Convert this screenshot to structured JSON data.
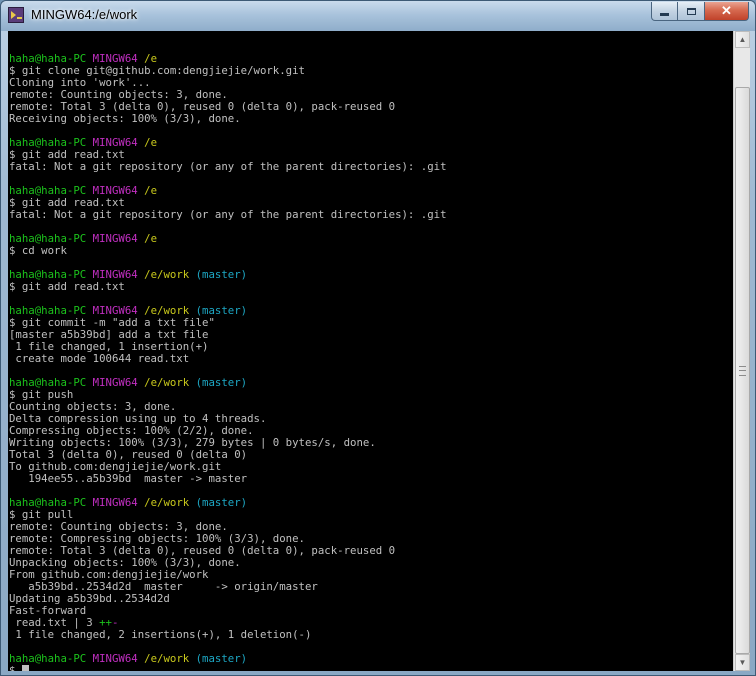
{
  "window": {
    "title": "MINGW64:/e/work",
    "app_icon": "git-bash-icon",
    "controls": [
      "minimize-icon",
      "maximize-icon",
      "close-icon"
    ]
  },
  "colors": {
    "terminal_bg": "#000000",
    "text": "#c0c0c0",
    "user": "#1cc21c",
    "mingw": "#c12fc1",
    "path": "#c8c81c",
    "branch": "#1da7c4"
  },
  "terminal": {
    "lines": [
      [],
      [
        {
          "t": "haha@haha-PC",
          "c": "g"
        },
        {
          "t": " "
        },
        {
          "t": "MINGW64",
          "c": "m"
        },
        {
          "t": " "
        },
        {
          "t": "/e",
          "c": "y"
        }
      ],
      [
        {
          "t": "$ git clone git@github.com:dengjiejie/work.git"
        }
      ],
      [
        {
          "t": "Cloning into 'work'..."
        }
      ],
      [
        {
          "t": "remote: Counting objects: 3, done."
        }
      ],
      [
        {
          "t": "remote: Total 3 (delta 0), reused 0 (delta 0), pack-reused 0"
        }
      ],
      [
        {
          "t": "Receiving objects: 100% (3/3), done."
        }
      ],
      [],
      [
        {
          "t": "haha@haha-PC",
          "c": "g"
        },
        {
          "t": " "
        },
        {
          "t": "MINGW64",
          "c": "m"
        },
        {
          "t": " "
        },
        {
          "t": "/e",
          "c": "y"
        }
      ],
      [
        {
          "t": "$ git add read.txt"
        }
      ],
      [
        {
          "t": "fatal: Not a git repository (or any of the parent directories): .git"
        }
      ],
      [],
      [
        {
          "t": "haha@haha-PC",
          "c": "g"
        },
        {
          "t": " "
        },
        {
          "t": "MINGW64",
          "c": "m"
        },
        {
          "t": " "
        },
        {
          "t": "/e",
          "c": "y"
        }
      ],
      [
        {
          "t": "$ git add read.txt"
        }
      ],
      [
        {
          "t": "fatal: Not a git repository (or any of the parent directories): .git"
        }
      ],
      [],
      [
        {
          "t": "haha@haha-PC",
          "c": "g"
        },
        {
          "t": " "
        },
        {
          "t": "MINGW64",
          "c": "m"
        },
        {
          "t": " "
        },
        {
          "t": "/e",
          "c": "y"
        }
      ],
      [
        {
          "t": "$ cd work"
        }
      ],
      [],
      [
        {
          "t": "haha@haha-PC",
          "c": "g"
        },
        {
          "t": " "
        },
        {
          "t": "MINGW64",
          "c": "m"
        },
        {
          "t": " "
        },
        {
          "t": "/e/work",
          "c": "y"
        },
        {
          "t": " "
        },
        {
          "t": "(master)",
          "c": "c"
        }
      ],
      [
        {
          "t": "$ git add read.txt"
        }
      ],
      [],
      [
        {
          "t": "haha@haha-PC",
          "c": "g"
        },
        {
          "t": " "
        },
        {
          "t": "MINGW64",
          "c": "m"
        },
        {
          "t": " "
        },
        {
          "t": "/e/work",
          "c": "y"
        },
        {
          "t": " "
        },
        {
          "t": "(master)",
          "c": "c"
        }
      ],
      [
        {
          "t": "$ git commit -m \"add a txt file\""
        }
      ],
      [
        {
          "t": "[master a5b39bd] add a txt file"
        }
      ],
      [
        {
          "t": " 1 file changed, 1 insertion(+)"
        }
      ],
      [
        {
          "t": " create mode 100644 read.txt"
        }
      ],
      [],
      [
        {
          "t": "haha@haha-PC",
          "c": "g"
        },
        {
          "t": " "
        },
        {
          "t": "MINGW64",
          "c": "m"
        },
        {
          "t": " "
        },
        {
          "t": "/e/work",
          "c": "y"
        },
        {
          "t": " "
        },
        {
          "t": "(master)",
          "c": "c"
        }
      ],
      [
        {
          "t": "$ git push"
        }
      ],
      [
        {
          "t": "Counting objects: 3, done."
        }
      ],
      [
        {
          "t": "Delta compression using up to 4 threads."
        }
      ],
      [
        {
          "t": "Compressing objects: 100% (2/2), done."
        }
      ],
      [
        {
          "t": "Writing objects: 100% (3/3), 279 bytes | 0 bytes/s, done."
        }
      ],
      [
        {
          "t": "Total 3 (delta 0), reused 0 (delta 0)"
        }
      ],
      [
        {
          "t": "To github.com:dengjiejie/work.git"
        }
      ],
      [
        {
          "t": "   194ee55..a5b39bd  master -> master"
        }
      ],
      [],
      [
        {
          "t": "haha@haha-PC",
          "c": "g"
        },
        {
          "t": " "
        },
        {
          "t": "MINGW64",
          "c": "m"
        },
        {
          "t": " "
        },
        {
          "t": "/e/work",
          "c": "y"
        },
        {
          "t": " "
        },
        {
          "t": "(master)",
          "c": "c"
        }
      ],
      [
        {
          "t": "$ git pull"
        }
      ],
      [
        {
          "t": "remote: Counting objects: 3, done."
        }
      ],
      [
        {
          "t": "remote: Compressing objects: 100% (3/3), done."
        }
      ],
      [
        {
          "t": "remote: Total 3 (delta 0), reused 0 (delta 0), pack-reused 0"
        }
      ],
      [
        {
          "t": "Unpacking objects: 100% (3/3), done."
        }
      ],
      [
        {
          "t": "From github.com:dengjiejie/work"
        }
      ],
      [
        {
          "t": "   a5b39bd..2534d2d  master     -> origin/master"
        }
      ],
      [
        {
          "t": "Updating a5b39bd..2534d2d"
        }
      ],
      [
        {
          "t": "Fast-forward"
        }
      ],
      [
        {
          "t": " read.txt | 3 "
        },
        {
          "t": "++",
          "c": "g"
        },
        {
          "t": "-",
          "c": "m"
        }
      ],
      [
        {
          "t": " 1 file changed, 2 insertions(+), 1 deletion(-)"
        }
      ],
      [],
      [
        {
          "t": "haha@haha-PC",
          "c": "g"
        },
        {
          "t": " "
        },
        {
          "t": "MINGW64",
          "c": "m"
        },
        {
          "t": " "
        },
        {
          "t": "/e/work",
          "c": "y"
        },
        {
          "t": " "
        },
        {
          "t": "(master)",
          "c": "c"
        }
      ],
      [
        {
          "t": "$ "
        }
      ]
    ]
  },
  "scrollbar": {
    "up_arrow": "▲",
    "down_arrow": "▼",
    "position": 0.96
  }
}
